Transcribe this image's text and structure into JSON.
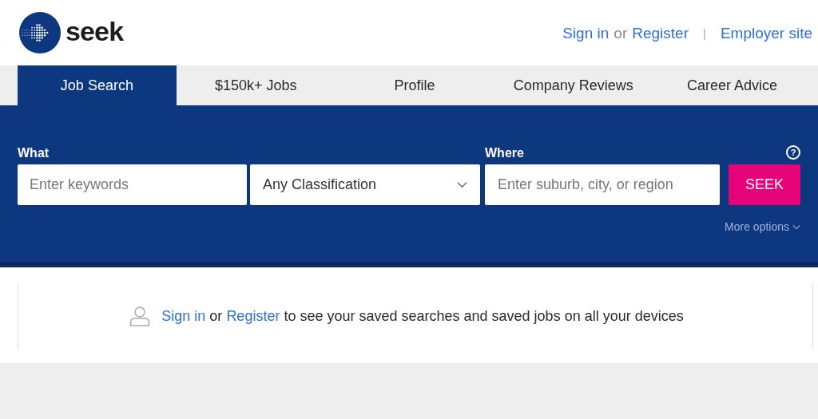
{
  "header": {
    "logo_text": "seek",
    "links": [
      {
        "label": "Sign in",
        "kind": "link"
      },
      {
        "label": "or",
        "kind": "text"
      },
      {
        "label": "Register",
        "kind": "link"
      },
      {
        "label": "|",
        "kind": "divider"
      },
      {
        "label": "Employer site",
        "kind": "link"
      }
    ]
  },
  "tabs": [
    {
      "label": "Job Search",
      "selected": true
    },
    {
      "label": "$150k+ Jobs",
      "selected": false
    },
    {
      "label": "Profile",
      "selected": false
    },
    {
      "label": "Company Reviews",
      "selected": false
    },
    {
      "label": "Career Advice",
      "selected": false
    }
  ],
  "search": {
    "what_label": "What",
    "keywords": {
      "placeholder": "Enter keywords"
    },
    "classification": "Any Classification",
    "where_label": "Where",
    "location": {
      "placeholder": "Enter suburb, city, or region"
    },
    "help": "?",
    "button": "SEEK",
    "more_options": "More options"
  },
  "banner": {
    "sign_in": "Sign in",
    "or": "or",
    "register": "Register",
    "message": "to see your saved searches and saved jobs on all your devices"
  }
}
